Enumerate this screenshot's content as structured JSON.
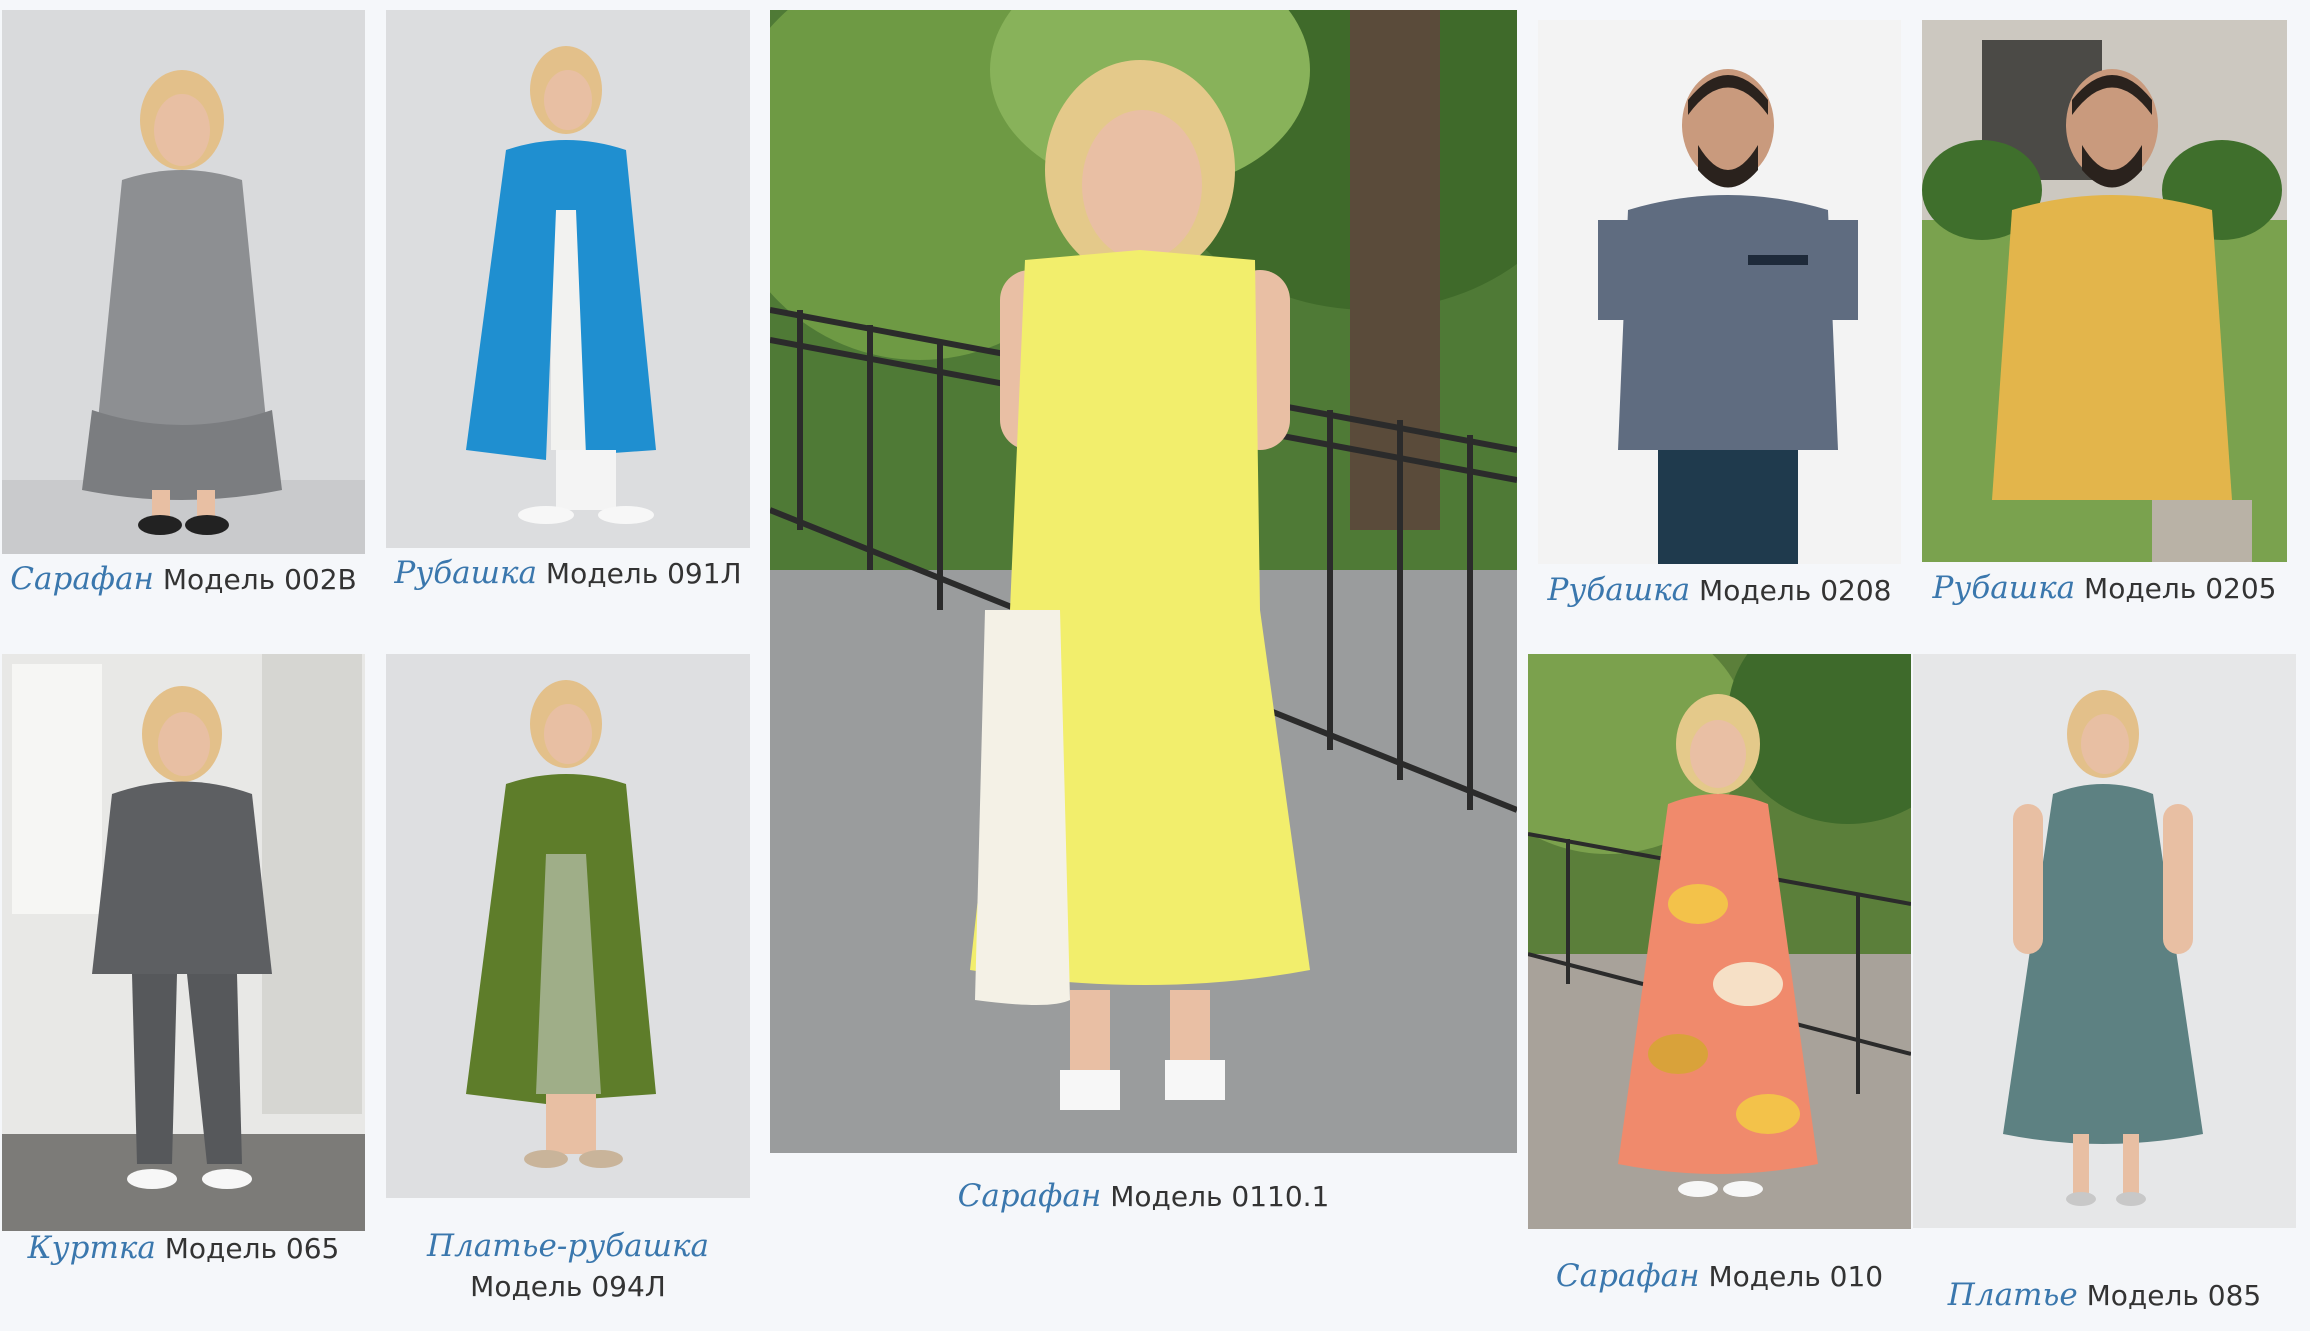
{
  "colors": {
    "link": "#3a77ad",
    "text": "#333333",
    "page_bg": "#f5f7fa"
  },
  "items": [
    {
      "type": "Сарафан",
      "model": "Модель 002В"
    },
    {
      "type": "Рубашка",
      "model": "Модель 091Л"
    },
    {
      "type": "Сарафан",
      "model": "Модель 0110.1"
    },
    {
      "type": "Рубашка",
      "model": "Модель 0208"
    },
    {
      "type": "Рубашка",
      "model": "Модель 0205"
    },
    {
      "type": "Куртка",
      "model": "Модель 065"
    },
    {
      "type": "Платье-рубашка",
      "model": "Модель 094Л"
    },
    {
      "type": "Сарафан",
      "model": "Модель 010"
    },
    {
      "type": "Платье",
      "model": "Модель 085"
    }
  ]
}
